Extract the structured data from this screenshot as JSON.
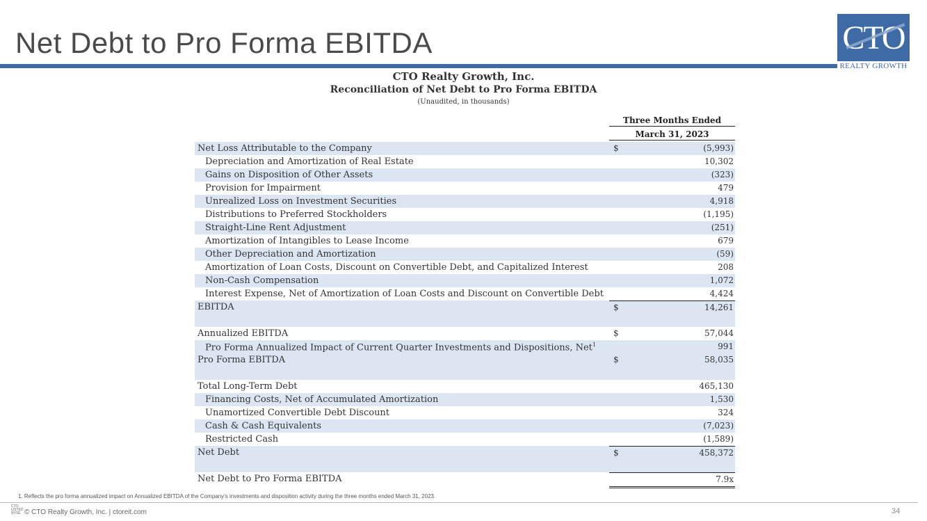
{
  "slide": {
    "title": "Net Debt to Pro Forma EBITDA",
    "page_number": "34",
    "accent_color": "#3e6aa6"
  },
  "logo": {
    "text": "CTO",
    "subtext": "REALTY GROWTH"
  },
  "report": {
    "company": "CTO Realty Growth, Inc.",
    "title": "Reconciliation of Net Debt to Pro Forma EBITDA",
    "units": "(Unaudited, in thousands)",
    "column_header_1": "Three Months Ended",
    "column_header_2": "March 31, 2023"
  },
  "rows": [
    {
      "label": "Net Loss Attributable to the Company",
      "dollar": "$",
      "value": "(5,993)"
    },
    {
      "label": "Depreciation and Amortization of Real Estate",
      "dollar": "",
      "value": "10,302"
    },
    {
      "label": "Gains on Disposition of Other Assets",
      "dollar": "",
      "value": "(323)"
    },
    {
      "label": "Provision for Impairment",
      "dollar": "",
      "value": "479"
    },
    {
      "label": "Unrealized Loss on Investment Securities",
      "dollar": "",
      "value": "4,918"
    },
    {
      "label": "Distributions to Preferred Stockholders",
      "dollar": "",
      "value": "(1,195)"
    },
    {
      "label": "Straight-Line Rent Adjustment",
      "dollar": "",
      "value": "(251)"
    },
    {
      "label": "Amortization of Intangibles to Lease Income",
      "dollar": "",
      "value": "679"
    },
    {
      "label": "Other Depreciation and Amortization",
      "dollar": "",
      "value": "(59)"
    },
    {
      "label": "Amortization of Loan Costs, Discount on Convertible Debt, and Capitalized Interest",
      "dollar": "",
      "value": "208"
    },
    {
      "label": "Non-Cash Compensation",
      "dollar": "",
      "value": "1,072"
    },
    {
      "label": "Interest Expense, Net of Amortization of Loan Costs and Discount on Convertible Debt",
      "dollar": "",
      "value": "4,424"
    },
    {
      "label": "EBITDA",
      "dollar": "$",
      "value": "14,261"
    },
    {
      "label": "",
      "dollar": "",
      "value": ""
    },
    {
      "label": "Annualized EBITDA",
      "dollar": "$",
      "value": "57,044"
    },
    {
      "label": "Pro Forma Annualized Impact of Current Quarter Investments and Dispositions, Net",
      "sup": "1",
      "dollar": "",
      "value": "991"
    },
    {
      "label": "Pro Forma EBITDA",
      "dollar": "$",
      "value": "58,035"
    },
    {
      "label": "",
      "dollar": "",
      "value": ""
    },
    {
      "label": "Total Long-Term Debt",
      "dollar": "",
      "value": "465,130"
    },
    {
      "label": "Financing Costs, Net of Accumulated Amortization",
      "dollar": "",
      "value": "1,530"
    },
    {
      "label": "Unamortized Convertible Debt Discount",
      "dollar": "",
      "value": "324"
    },
    {
      "label": "Cash & Cash Equivalents",
      "dollar": "",
      "value": "(7,023)"
    },
    {
      "label": "Restricted Cash",
      "dollar": "",
      "value": "(1,589)"
    },
    {
      "label": "Net Debt",
      "dollar": "$",
      "value": "458,372"
    },
    {
      "label": "",
      "dollar": "",
      "value": ""
    },
    {
      "label": "Net Debt to Pro Forma EBITDA",
      "dollar": "",
      "value": "7.9x"
    }
  ],
  "footnote": "1.      Reflects the pro forma annualized impact on Annualized EBITDA of the Company’s investments and disposition activity during the three months ended March 31, 2023.",
  "footer": {
    "copyright": "© CTO Realty Growth, Inc. | ctoreit.com",
    "exchange_mark": "CTO\nLISTED\nNYSE"
  }
}
